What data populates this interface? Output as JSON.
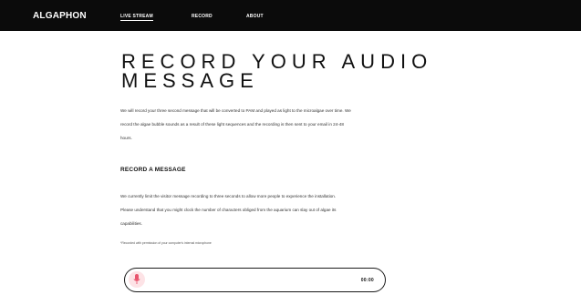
{
  "header": {
    "brand": "ALGAPHON",
    "nav": [
      "LIVE STREAM",
      "RECORD",
      "ABOUT"
    ]
  },
  "main": {
    "title": "RECORD YOUR AUDIO MESSAGE",
    "intro_line1": "We will record your three second message that will be converted to PAM and played as light to the microalgae over time. We",
    "intro_line2": "record the algae bubble sounds as a result of these light sequences and the recording is then sent to your email in 24-48",
    "intro_line3": "hours.",
    "subhead": "RECORD A MESSAGE",
    "body_line1": "We currently limit the visitor message recording to three seconds to allow more people to experience the installation.",
    "body_line2": "Please understand that you might clock the number of characters obliged from the aquarium can slay out of algae its",
    "body_line3": "capabilities.",
    "footnote": "*Recorded with permission of your computer's internal microphone"
  },
  "recorder": {
    "timer": "00:00",
    "icon": "microphone-icon"
  },
  "colors": {
    "topbar": "#0b0b0b",
    "mic_bg": "#fde3e6",
    "mic_accent": "#e8556e"
  }
}
